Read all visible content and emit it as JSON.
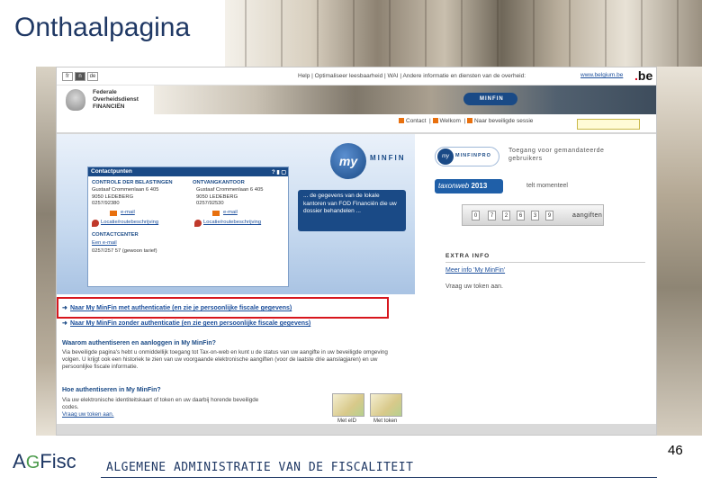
{
  "slide": {
    "title": "Onthaalpagina",
    "page_number": "46",
    "footer_text": "ALGEMENE ADMINISTRATIE VAN DE FISCALITEIT",
    "logo": {
      "part1": "A",
      "part2": "G",
      "part3": "Fisc"
    }
  },
  "topbar": {
    "languages": [
      "fr",
      "n",
      "de"
    ],
    "active_language": "n",
    "links": "Help  |  Optimaliseer leesbaarheid  |  WAI  |  Andere informatie en diensten van de overheid:",
    "belgium_link": "www.belgium.be",
    "be_logo": "be"
  },
  "header": {
    "org_name": "Federale\nOverheidsdienst\nFINANCIËN",
    "minfin_badge": "MINFIN"
  },
  "nav": {
    "items": [
      "Contact",
      "Welkom",
      "Naar beveiligde sessie"
    ]
  },
  "left": {
    "my_logo": "my",
    "minfin_text": "MINFIN",
    "contact": {
      "title": "Contactpunten",
      "icons": "? ▮ ▢",
      "col1": {
        "head": "CONTROLE DER BELASTINGEN",
        "address": "Gustaaf Crommenlaan 6 405\n9050 LEDEBERG\n0257/92380",
        "email": "e-mail",
        "location": "Locatie/routebeschrijving"
      },
      "col2": {
        "head": "ONTVANGKANTOOR",
        "address": "Gustaaf Crommenlaan 6 405\n9050 LEDEBERG\n0257/92530",
        "email": "e-mail",
        "location": "Locatie/routebeschrijving"
      },
      "contactcenter": {
        "head": "CONTACTCENTER",
        "email": "Een e-mail",
        "phone": "0257/257 57 (gewoon tarief)"
      }
    },
    "callout": "... de gegevens van de lokale kantoren van FOD Financiën die uw dossier behandelen ..."
  },
  "right": {
    "minfinpro": {
      "badge_my": "my",
      "badge_text": "MINFINPRO",
      "desc": "Toegang voor gemandateerde\ngebruikers"
    },
    "taxonweb": {
      "name": "taxonweb",
      "year": "2013",
      "desc": "telt momenteel"
    },
    "counter": {
      "digits": [
        "0",
        "7",
        "2",
        "6",
        "3",
        "9"
      ],
      "label": "aangiften"
    },
    "extra": {
      "heading": "EXTRA INFO",
      "link": "Meer info 'My MinFin'",
      "text": "Vraag uw token aan."
    }
  },
  "auth": {
    "with_auth": "Naar My MinFin met authenticatie (en zie je persoonlijke fiscale gegevens)",
    "without_auth": "Naar My MinFin zonder authenticatie (en zie geen persoonlijke fiscale gegevens)"
  },
  "sections": {
    "why_heading": "Waarom authentiseren en aanloggen in My MinFin?",
    "why_text": "Via beveiligde pagina's hebt u onmiddellijk toegang tot Tax-on-web en kunt u de status van uw aangifte in uw beveiligde omgeving volgen. U krijgt ook een historiek te zien van uw voorgaande elektronische aangiften (voor de laatste drie aanslagjaren) en uw persoonlijke fiscale informatie.",
    "how_heading": "Hoe authentiseren in My MinFin?",
    "how_text_1": "Via uw elektronische identiteitskaart of token en uw daarbij horende beveiligde",
    "how_text_2": "codes.",
    "how_link": "Vraag uw token aan.",
    "card1_label": "Met eID",
    "card2_label": "Met token"
  }
}
